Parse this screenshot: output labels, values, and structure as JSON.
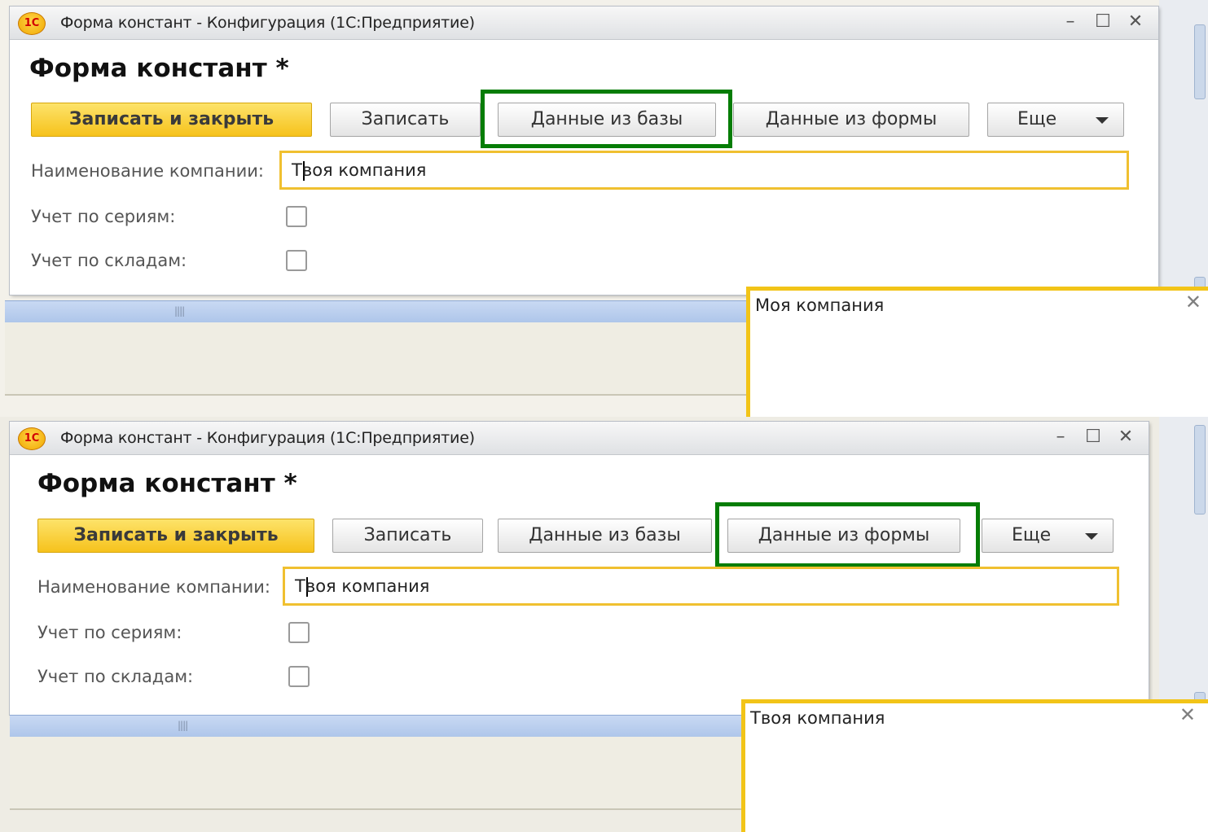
{
  "windows": [
    {
      "title": "Форма констант - Конфигурация  (1С:Предприятие)",
      "logo": "1С",
      "controls": {
        "minimize": "–",
        "maximize": "☐",
        "close": "✕"
      },
      "form_title": "Форма констант *",
      "buttons": {
        "save_close": "Записать и закрыть",
        "save": "Записать",
        "data_from_db": "Данные из базы",
        "data_from_form": "Данные из формы",
        "more": "Еще"
      },
      "highlighted_button": "data_from_db",
      "fields": {
        "company_label": "Наименование компании:",
        "company_value_first": "Т",
        "company_value_rest": "воя компания",
        "series_label": "Учет по сериям:",
        "series_checked": false,
        "warehouses_label": "Учет по складам:",
        "warehouses_checked": false
      },
      "message": {
        "text": "Моя компания",
        "close": "✕"
      }
    },
    {
      "title": "Форма констант - Конфигурация  (1С:Предприятие)",
      "logo": "1С",
      "controls": {
        "minimize": "–",
        "maximize": "☐",
        "close": "✕"
      },
      "form_title": "Форма констант *",
      "buttons": {
        "save_close": "Записать и закрыть",
        "save": "Записать",
        "data_from_db": "Данные из базы",
        "data_from_form": "Данные из формы",
        "more": "Еще"
      },
      "highlighted_button": "data_from_form",
      "fields": {
        "company_label": "Наименование компании:",
        "company_value_first": "Т",
        "company_value_rest": "воя компания",
        "series_label": "Учет по сериям:",
        "series_checked": false,
        "warehouses_label": "Учет по складам:",
        "warehouses_checked": false
      },
      "message": {
        "text": "Твоя компания",
        "close": "✕"
      }
    }
  ],
  "colors": {
    "highlight_border": "#067d06",
    "input_border": "#f0c030",
    "primary_button": "#f6c21c",
    "message_border": "#f2c418"
  }
}
